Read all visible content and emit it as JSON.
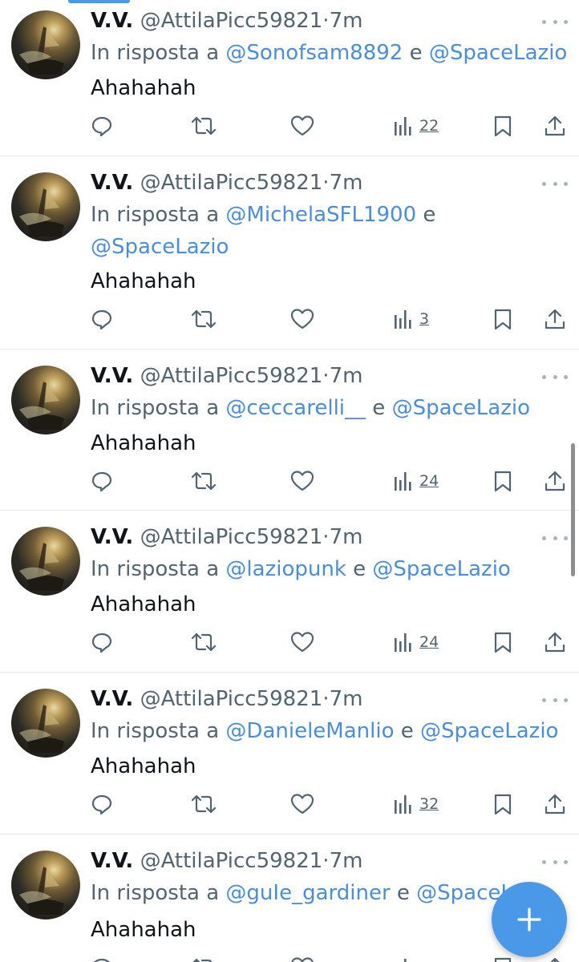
{
  "tweets": [
    {
      "name": "V.V.",
      "handle": "@AttilaPicc59821",
      "time": "7m",
      "reply_prefix": "In risposta a",
      "mention1": "@Sonofsam8892",
      "joiner": "e",
      "mention2": "@SpaceLazio",
      "text": "Ahahahah",
      "views": "22"
    },
    {
      "name": "V.V.",
      "handle": "@AttilaPicc59821",
      "time": "7m",
      "reply_prefix": "In risposta a",
      "mention1": "@MichelaSFL1900",
      "joiner": "e",
      "mention2": "@SpaceLazio",
      "text": "Ahahahah",
      "views": "3"
    },
    {
      "name": "V.V.",
      "handle": "@AttilaPicc59821",
      "time": "7m",
      "reply_prefix": "In risposta a",
      "mention1": "@ceccarelli__",
      "joiner": "e",
      "mention2": "@SpaceLazio",
      "text": "Ahahahah",
      "views": "24"
    },
    {
      "name": "V.V.",
      "handle": "@AttilaPicc59821",
      "time": "7m",
      "reply_prefix": "In risposta a",
      "mention1": "@laziopunk",
      "joiner": "e",
      "mention2": "@SpaceLazio",
      "text": "Ahahahah",
      "views": "24"
    },
    {
      "name": "V.V.",
      "handle": "@AttilaPicc59821",
      "time": "7m",
      "reply_prefix": "In risposta a",
      "mention1": "@DanieleManlio",
      "joiner": "e",
      "mention2": "@SpaceLazio",
      "text": "Ahahahah",
      "views": "32"
    },
    {
      "name": "V.V.",
      "handle": "@AttilaPicc59821",
      "time": "7m",
      "reply_prefix": "In risposta a",
      "mention1": "@guIe_gardiner",
      "joiner": "e",
      "mention2": "@SpaceLazio",
      "text": "Ahahahah",
      "views": ""
    }
  ],
  "separator": "·",
  "icons": {
    "reply": "reply-icon",
    "retweet": "retweet-icon",
    "like": "heart-icon",
    "views": "views-bar-chart-icon",
    "bookmark": "bookmark-icon",
    "share": "share-icon",
    "more": "more-dots-icon",
    "compose": "plus-icon"
  },
  "colors": {
    "accent": "#4a99e9",
    "mention": "#4a8ed9",
    "secondary_text": "#536471",
    "primary_text": "#0f1419"
  }
}
